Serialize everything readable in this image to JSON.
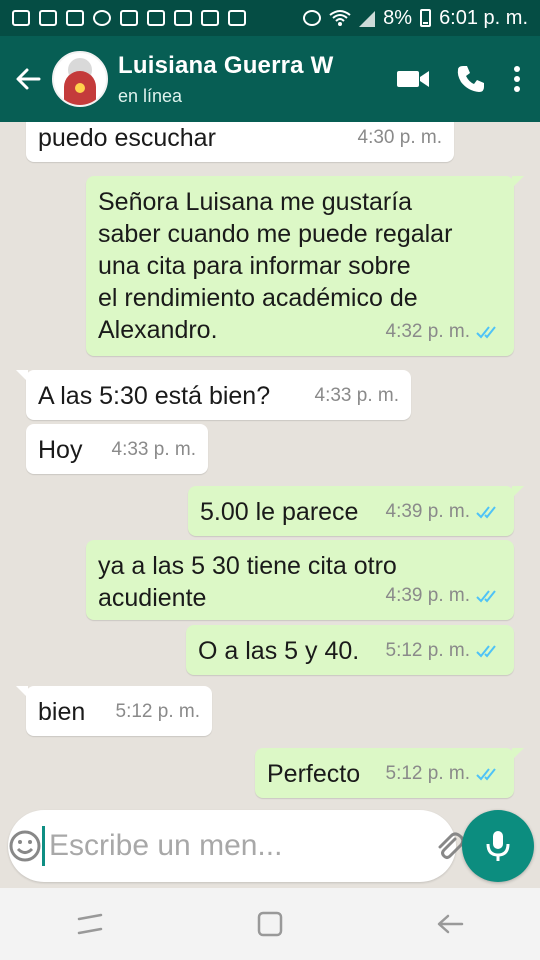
{
  "status_bar": {
    "battery": "8%",
    "time": "6:01 p. m."
  },
  "header": {
    "contact_name": "Luisiana Guerra W",
    "presence": "en línea"
  },
  "messages": [
    {
      "direction": "in",
      "text": "puedo escuchar",
      "time": "4:30 p. m."
    },
    {
      "direction": "out",
      "lines": [
        "Señora Luisana me gustaría",
        "saber cuando me puede regalar",
        "una cita para informar sobre",
        "el rendimiento académico de",
        "Alexandro."
      ],
      "time": "4:32 p. m.",
      "read": true
    },
    {
      "direction": "in",
      "text": "A las 5:30 está bien?",
      "time": "4:33 p. m."
    },
    {
      "direction": "in",
      "text": "Hoy",
      "time": "4:33 p. m."
    },
    {
      "direction": "out",
      "text": "5.00 le parece",
      "time": "4:39 p. m.",
      "read": true
    },
    {
      "direction": "out",
      "lines": [
        "ya a las 5 30 tiene cita otro",
        "acudiente"
      ],
      "time": "4:39 p. m.",
      "read": true
    },
    {
      "direction": "out",
      "text": "O a las 5 y 40.",
      "time": "5:12 p. m.",
      "read": true
    },
    {
      "direction": "in",
      "text": "bien",
      "time": "5:12 p. m."
    },
    {
      "direction": "out",
      "text": "Perfecto",
      "time": "5:12 p. m.",
      "read": true
    }
  ],
  "composer": {
    "placeholder": "Escribe un men..."
  },
  "icons": {
    "back": "arrow-left-icon",
    "video": "video-call-icon",
    "call": "phone-call-icon",
    "menu": "more-vertical-icon",
    "emoji": "emoji-icon",
    "attach": "paperclip-icon",
    "camera": "camera-icon",
    "mic": "microphone-icon"
  },
  "colors": {
    "header": "#075e54",
    "status_bar": "#054d44",
    "outgoing_bubble": "#dcf8c6",
    "incoming_bubble": "#ffffff",
    "read_ticks": "#4fc3f7",
    "mic_button": "#0c8d7f"
  }
}
